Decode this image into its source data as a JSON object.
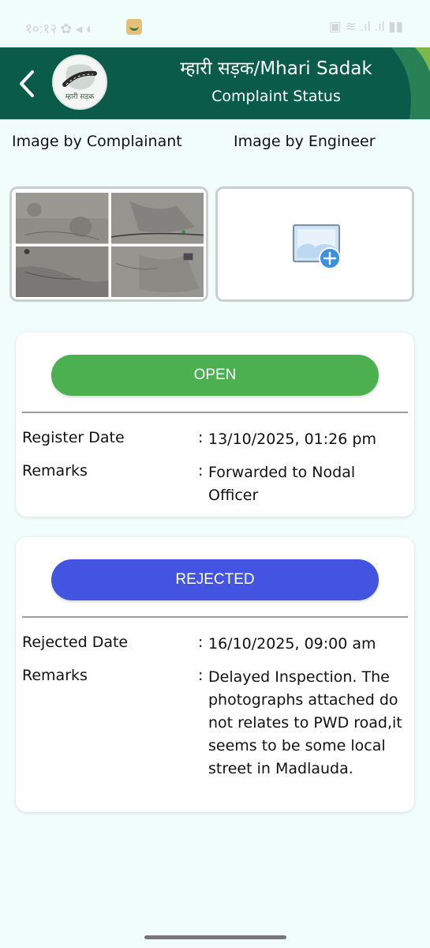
{
  "status_bar": {
    "left_text": "१०:१२ ✿ ◂ ◐",
    "right_text": "▣ ≋ .ıl .ıl ▮▮"
  },
  "header": {
    "title": "म्हारी सड़क/Mhari Sadak",
    "subtitle": "Complaint Status",
    "logo_text": "म्हारी सड़क",
    "accent_color": "#0a5b49"
  },
  "images": {
    "complainant_label": "Image by Complainant",
    "engineer_label": "Image by Engineer"
  },
  "cards": [
    {
      "status": "OPEN",
      "status_color": "#4caf50",
      "rows": [
        {
          "label": "Register Date",
          "value": "13/10/2025, 01:26 pm"
        },
        {
          "label": "Remarks",
          "value": "Forwarded to Nodal Officer"
        }
      ]
    },
    {
      "status": "REJECTED",
      "status_color": "#4355e0",
      "rows": [
        {
          "label": "Rejected Date",
          "value": "16/10/2025, 09:00 am"
        },
        {
          "label": "Remarks",
          "value": "Delayed Inspection. The photographs attached do not relates to PWD road,it seems to be some local street in Madlauda."
        }
      ]
    }
  ],
  "colon": ":"
}
